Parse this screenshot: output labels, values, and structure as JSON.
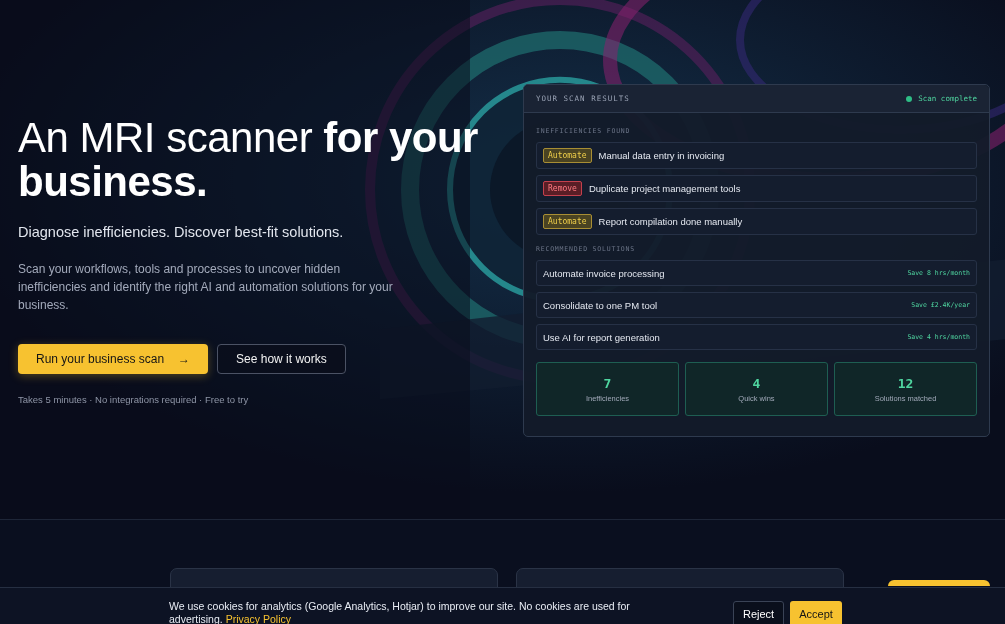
{
  "hero": {
    "title": "An MRI scanner **for your business.**",
    "subtitle": "Diagnose inefficiencies. Discover best-fit solutions.",
    "description": "Scan your workflows, tools and processes to uncover hidden inefficiencies and identify the right AI and automation solutions for your business.",
    "primary_button": "Run your business scan",
    "primary_icon": "→",
    "secondary_button": "See how it works",
    "footnote": "Takes 5 minutes · No integrations required · Free to try"
  },
  "results": {
    "title": "YOUR SCAN RESULTS",
    "status": "Scan complete",
    "inefficiencies_heading": "INEFFICIENCIES FOUND",
    "inefficiencies": [
      {
        "kind": "automate",
        "tag": "Automate",
        "text": "Manual data entry in invoicing"
      },
      {
        "kind": "remove",
        "tag": "Remove",
        "text": "Duplicate project management tools"
      },
      {
        "kind": "automate",
        "tag": "Automate",
        "text": "Report compilation done manually"
      }
    ],
    "solutions_heading": "RECOMMENDED SOLUTIONS",
    "solutions": [
      {
        "text": "Automate invoice processing",
        "saving": "Save 8 hrs/month"
      },
      {
        "text": "Consolidate to one PM tool",
        "saving": "Save £2.4K/year"
      },
      {
        "text": "Use AI for report generation",
        "saving": "Save 4 hrs/month"
      }
    ],
    "stats": [
      {
        "value": "7",
        "label": "Inefficiencies"
      },
      {
        "value": "4",
        "label": "Quick wins"
      },
      {
        "value": "12",
        "label": "Solutions matched"
      }
    ]
  },
  "cookie_banner": {
    "text": "We use cookies for analytics (Google Analytics, Hotjar) to improve our site. No cookies are used for advertising.",
    "link": "Privacy Policy",
    "reject": "Reject",
    "accept": "Accept"
  }
}
